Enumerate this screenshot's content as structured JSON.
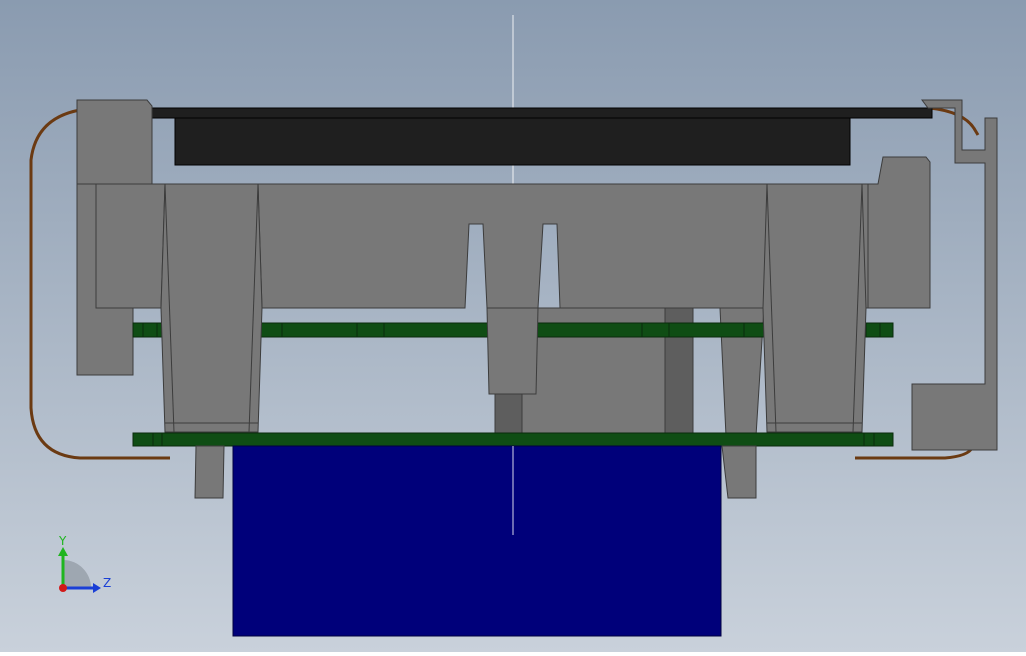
{
  "viewport": {
    "background_top": "#8a9bb0",
    "background_bottom": "#c9d1db"
  },
  "colors": {
    "housing_gray": "#787878",
    "housing_edge": "#3c3c3c",
    "dark_gray": "#5e5e5e",
    "black_panel": "#1f1f1f",
    "pcb_green": "#0f4d14",
    "pcb_edge": "#0a2a0c",
    "blue_block": "#00007a",
    "blue_edge": "#000040",
    "wire_brown": "#6b3a12",
    "center_line": "#ffffff"
  },
  "triad": {
    "y_label": "Y",
    "z_label": "Z",
    "y_color": "#1fb51f",
    "z_color": "#1a3fd6",
    "x_color": "#d11919",
    "arc_color": "#9aa3ad"
  }
}
